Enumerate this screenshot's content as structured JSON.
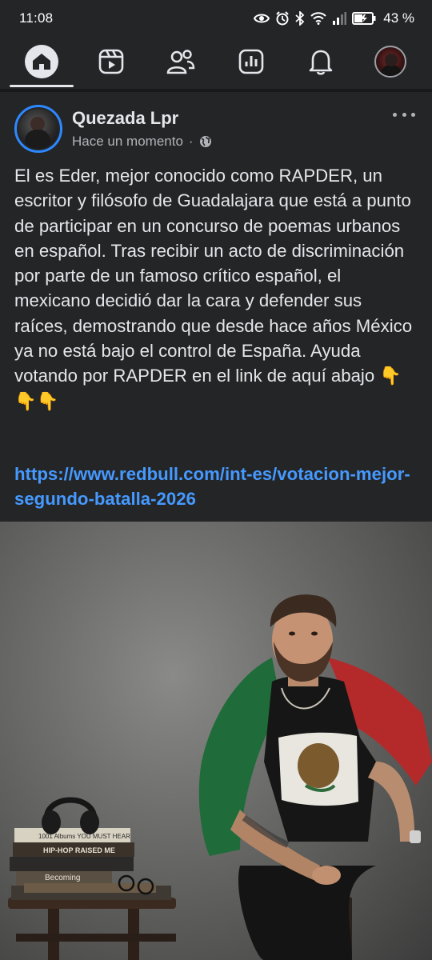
{
  "status_bar": {
    "time": "11:08",
    "battery_percent": "43 %",
    "icons": [
      "eye-icon",
      "alarm-icon",
      "bluetooth-icon",
      "wifi-icon",
      "signal-icon",
      "battery-icon"
    ]
  },
  "nav": {
    "items": [
      {
        "name": "home",
        "icon": "home-icon",
        "active": true
      },
      {
        "name": "video",
        "icon": "video-icon",
        "active": false
      },
      {
        "name": "friends",
        "icon": "friends-icon",
        "active": false
      },
      {
        "name": "dashboard",
        "icon": "dashboard-icon",
        "active": false
      },
      {
        "name": "notifications",
        "icon": "bell-icon",
        "active": false
      },
      {
        "name": "profile",
        "icon": "avatar",
        "active": false
      }
    ]
  },
  "post": {
    "author": "Quezada Lpr",
    "time": "Hace un momento",
    "separator": "·",
    "audience_icon": "globe-icon",
    "body": "El es Eder, mejor conocido como RAPDER, un escritor y filósofo de Guadalajara que está a punto de participar en un concurso de poemas urbanos en español. Tras recibir un acto de discriminación por parte de un famoso crítico español, el mexicano decidió dar la cara y defender sus raíces, demostrando que desde hace años México ya no está bajo el control de España. Ayuda votando por RAPDER en el link de aquí abajo 👇👇👇",
    "link": "https://www.redbull.com/int-es/votacion-mejor-segundo-batalla-2026",
    "book_titles": [
      "1001 Albums YOU MUST HEAR",
      "HIP-HOP RAISED ME",
      "Becoming"
    ]
  },
  "colors": {
    "background": "#242526",
    "link": "#4599ff",
    "avatar_ring": "#2d88ff",
    "flag_green": "#1f6b3a",
    "flag_red": "#b42a2a"
  }
}
